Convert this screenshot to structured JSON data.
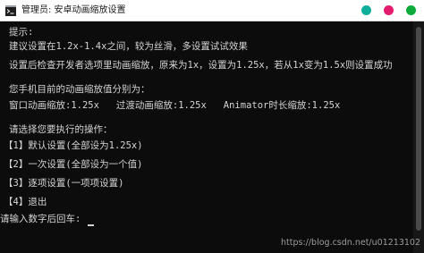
{
  "window": {
    "title": "管理员: 安卓动画缩放设置",
    "app_icon": "console-icon"
  },
  "console": {
    "lines": [
      "提示:",
      "建议设置在1.2x-1.4x之间，较为丝滑，多设置试试效果",
      "设置后检查开发者选项里动画缩放，原来为1x，设置为1.25x，若从1x变为1.5x则设置成功",
      "您手机目前的动画缩放值分别为：",
      "窗口动画缩放:1.25x   过渡动画缩放:1.25x   Animator时长缩放:1.25x",
      "请选择您要执行的操作：",
      "【1】默认设置(全部设为1.25x)",
      "【2】一次设置(全部设为一个值)",
      "【3】逐项设置(一项项设置)",
      "【4】退出",
      "请输入数字后回车:"
    ]
  },
  "watermark": "https://blog.csdn.net/u01213102"
}
